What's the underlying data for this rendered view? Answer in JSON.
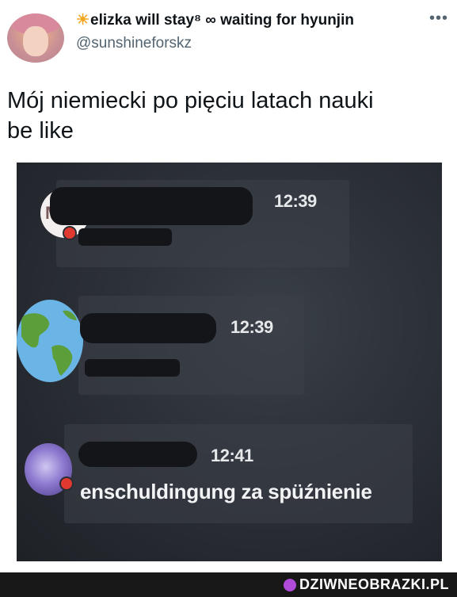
{
  "tweet": {
    "author_prefix_icon": "sun-emoji",
    "display_name": "elizka will stay⁸ ∞ waiting for hyunjin",
    "handle": "@sunshineforskz",
    "more_icon": "more-icon",
    "text_line1": "Mój niemiecki po pięciu latach nauki",
    "text_line2": "be like"
  },
  "photo": {
    "messages": [
      {
        "time": "12:39",
        "avatar_letter": "M"
      },
      {
        "time": "12:39"
      },
      {
        "time": "12:41",
        "text": "enschuldingung za spüźnienie"
      }
    ]
  },
  "footer": {
    "brand": "DZIWNEOBRAZKI.PL"
  }
}
